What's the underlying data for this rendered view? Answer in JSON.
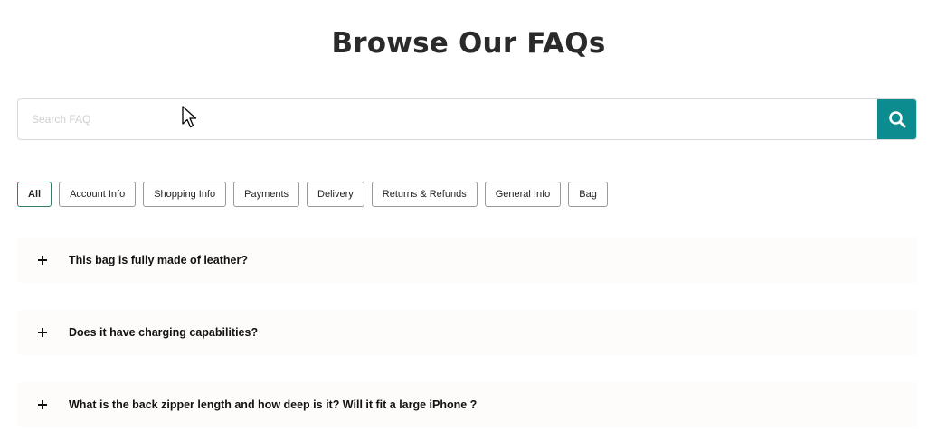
{
  "title": "Browse Our FAQs",
  "search": {
    "placeholder": "Search FAQ",
    "value": "",
    "button_icon": "search-icon",
    "button_color": "#0d8c8f"
  },
  "tabs": [
    {
      "label": "All",
      "active": true
    },
    {
      "label": "Account Info",
      "active": false
    },
    {
      "label": "Shopping Info",
      "active": false
    },
    {
      "label": "Payments",
      "active": false
    },
    {
      "label": "Delivery",
      "active": false
    },
    {
      "label": "Returns & Refunds",
      "active": false
    },
    {
      "label": "General Info",
      "active": false
    },
    {
      "label": "Bag",
      "active": false
    }
  ],
  "faqs": [
    {
      "icon": "plus-icon",
      "question": "This bag is fully made of leather?"
    },
    {
      "icon": "plus-icon",
      "question": "Does it have charging capabilities?"
    },
    {
      "icon": "plus-icon",
      "question": "What is the back zipper length and how deep is it? Will it fit a large iPhone ?"
    }
  ],
  "colors": {
    "accent": "#0d8c8f",
    "active_tab_border": "#2f7f5f",
    "faq_background": "#fdfcfa"
  }
}
